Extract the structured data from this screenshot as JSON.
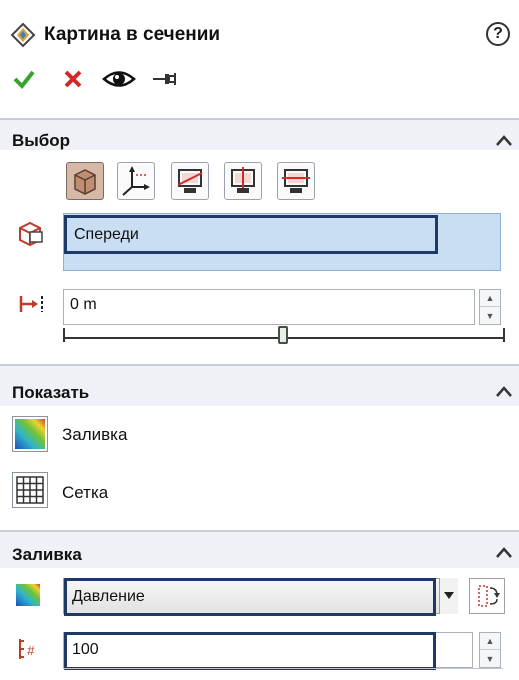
{
  "title": {
    "text": "Картина в сечении",
    "help_glyph": "?",
    "icon": "cut-plot-icon"
  },
  "actions": {
    "ok_icon": "check-icon",
    "cancel_icon": "close-icon",
    "preview_icon": "eye-icon",
    "pin_icon": "pushpin-icon"
  },
  "section_selection": {
    "title": "Выбор",
    "tools": [
      {
        "icon": "cube-section-icon",
        "active": true
      },
      {
        "icon": "axes-icon",
        "active": false
      },
      {
        "icon": "plane-x-icon",
        "active": false
      },
      {
        "icon": "plane-y-icon",
        "active": false
      },
      {
        "icon": "plane-z-icon",
        "active": false
      }
    ],
    "plane_label": "Спереди",
    "plane_icon": "reference-plane-icon",
    "offset_icon": "offset-distance-icon",
    "offset_value": "0 m",
    "slider_position": 0.5
  },
  "section_display": {
    "title": "Показать",
    "fill_label": "Заливка",
    "fill_icon": "contour-fill-icon",
    "mesh_label": "Сетка",
    "mesh_icon": "mesh-grid-icon"
  },
  "section_fill": {
    "title": "Заливка",
    "palette_icon": "color-palette-icon",
    "parameter": "Давление",
    "swap_icon": "swap-colors-icon",
    "levels_icon": "levels-count-icon",
    "levels_value": "100"
  },
  "colors": {
    "accent_outline": "#1d3a66",
    "selection_fill": "#c9def2",
    "ok_green": "#3aa22f",
    "cancel_red": "#d12a2a"
  }
}
